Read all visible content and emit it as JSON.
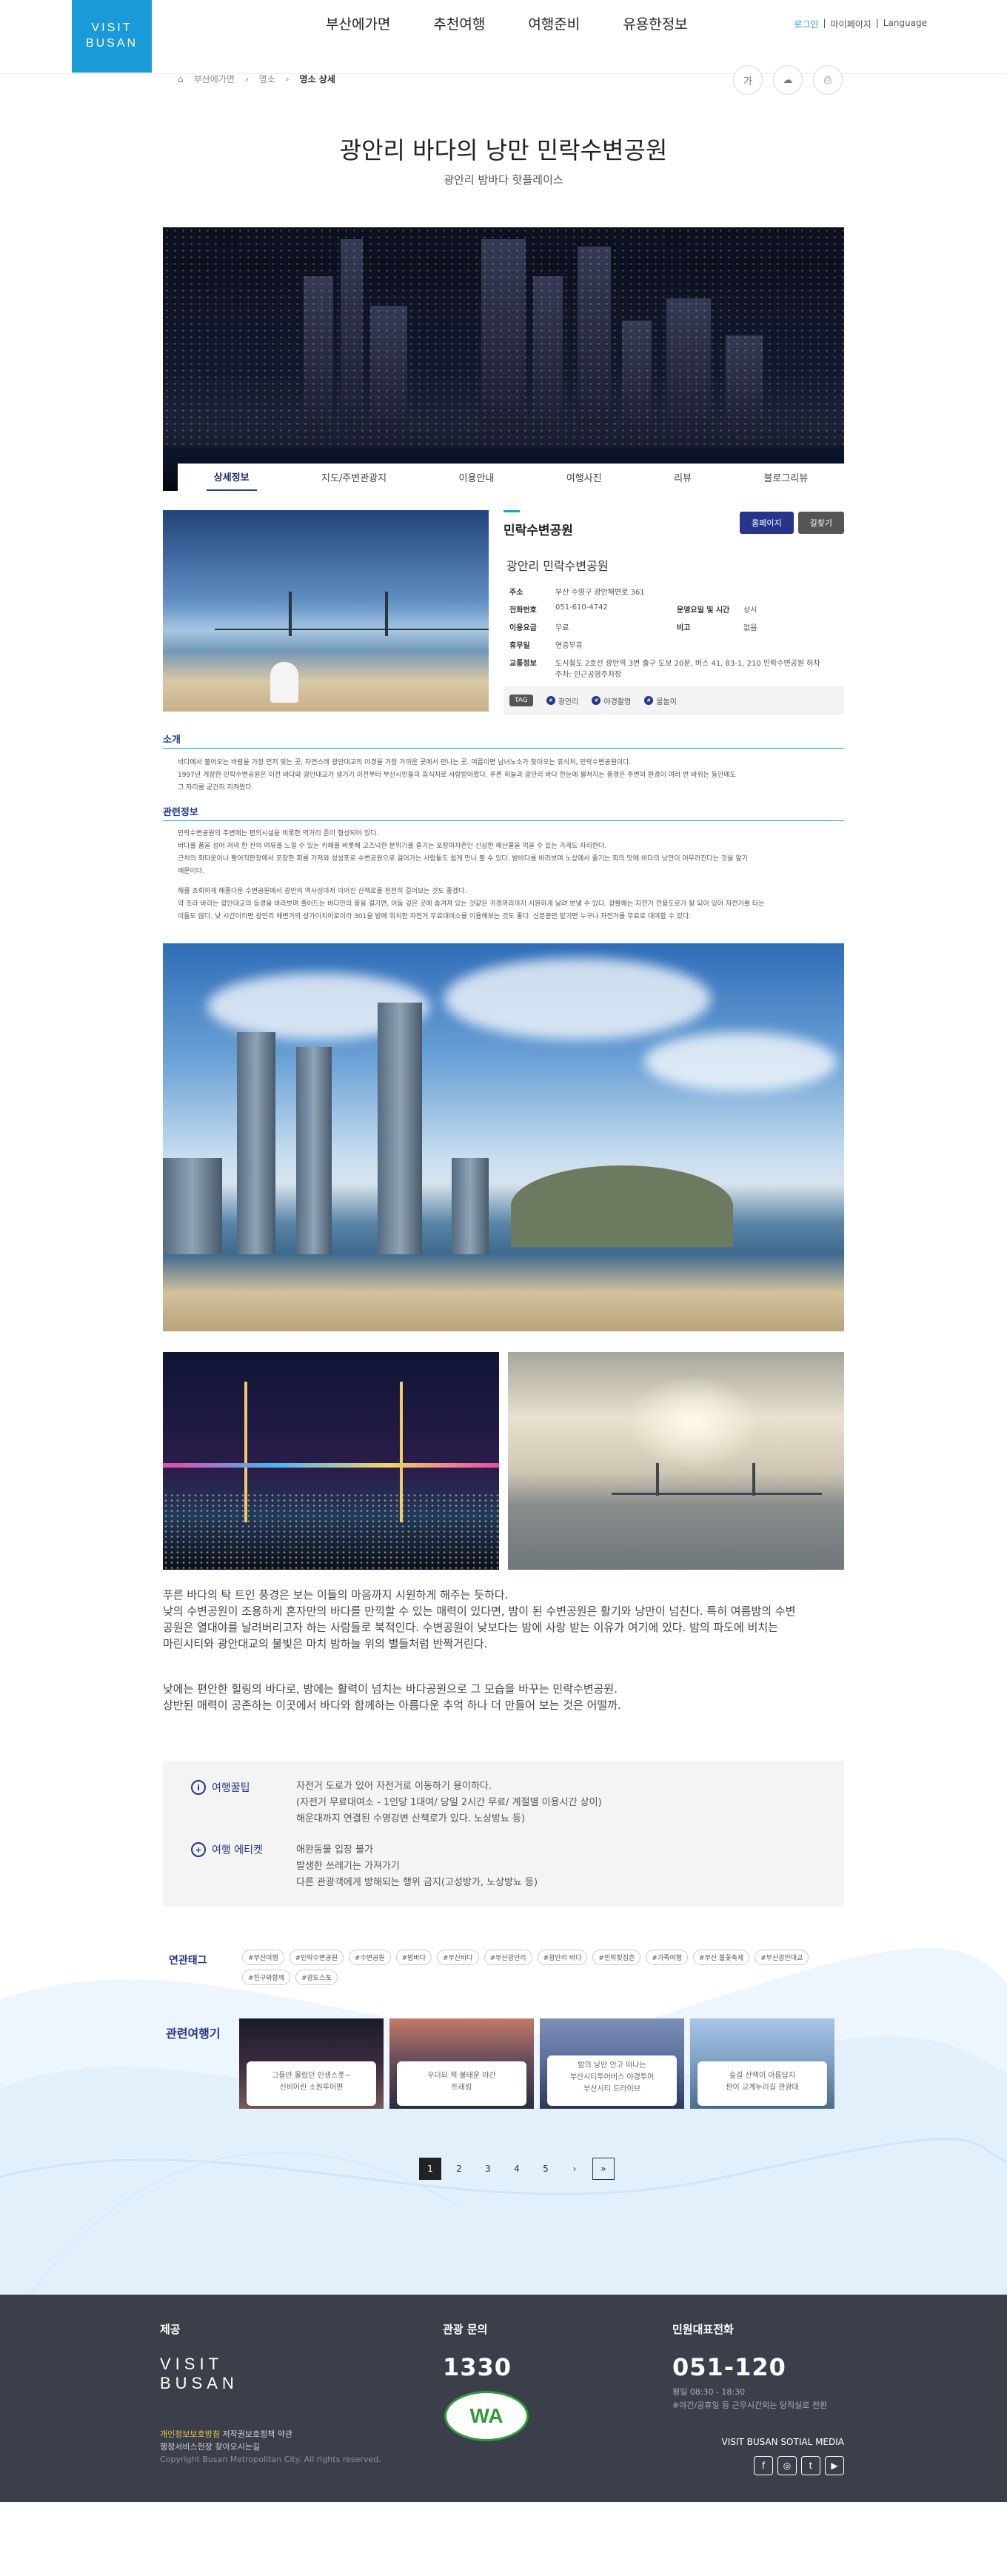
{
  "header": {
    "logo_line1": "VISIT",
    "logo_line2": "BUSAN",
    "nav": [
      "부산에가면",
      "추천여행",
      "여행준비",
      "유용한정보"
    ],
    "login": "로그인",
    "mypage": "마이페이지",
    "language": "Language"
  },
  "breadcrumb": [
    "부산에가면",
    "명소",
    "명소 상세"
  ],
  "tools": [
    "가",
    "",
    ""
  ],
  "title": "광안리 바다의 낭만 민락수변공원",
  "subtitle": "광안리 밤바다 핫플레이스",
  "tabs": [
    "상세정보",
    "지도/주변관광지",
    "이용안내",
    "여행사진",
    "리뷰",
    "블로그리뷰"
  ],
  "info": {
    "section_name": "민락수변공원",
    "home_btn": "홈페이지",
    "way_btn": "길찾기",
    "place_title": "광안리 민락수변공원",
    "addr_k": "주소",
    "addr_v": "부산 수영구 광안해변로 361",
    "tel_k": "전화번호",
    "tel_v": "051-610-4742",
    "hours_k": "운영요일 및 시간",
    "hours_v": "상시",
    "fee_k": "이용요금",
    "fee_v": "무료",
    "note_k": "비고",
    "note_v": "없음",
    "holiday_k": "휴무일",
    "holiday_v": "연중무휴",
    "traffic_k": "교통정보",
    "traffic_v": "도시철도 2호선 광안역 3번 출구 도보 20분, 버스 41, 83-1, 210 민락수변공원 하차",
    "traffic_v2": "주차: 인근공영주차장",
    "tag_label": "TAG",
    "tags": [
      "광안리",
      "야경촬영",
      "물놀이"
    ]
  },
  "sections": {
    "intro_h": "소개",
    "intro": "바다에서 불어오는 바람을 가장 먼저 맞는 곳, 자연스레 광안대교의 야경을 가장 가까운 곳에서 만나는 곳. 여름이면 남녀노소가 찾아오는 휴식처, 민락수변공원이다.",
    "intro2": "1997년 개장한 민락수변공원은 이전 바다와 광안대교가 생기기 이전부터 부산시민들의 휴식처로 사랑받아왔다. 푸른 하늘과 광안리 바다 한눈에 펼쳐지는 풍경은 주변의 환경이 여러 번 바뀌는 동안에도",
    "intro3": "그 자리를 굳건히 지켜왔다.",
    "detail_h": "관련정보",
    "d1": "민락수변공원의 주변에는 편의시설을 비롯한 먹거리 존이 형성되어 있다.",
    "d2": "바다를 품을 성어 저녁 한 잔의 여유를 느낄 수 있는 카페를 비롯해 고즈넉한 분위기를 즐기는 포장마차촌인 신상한 해산물을 먹을 수 있는 가게도 자리한다.",
    "d3": "근처의 회타운이나 활어직판장에서 포장한 회를 가져와 성성포로 수변공원으로 걸어가는 사람들도 쉽게 만나 볼 수 있다. 밤바다를 바라보며 노상에서 즐기는 회의 맛에 바다의 낭만이 어우러진다는 것을 알기",
    "d4": "때문이다.",
    "d5": "해를 조회하게 해풍다운 수변공원에서 광안의 역사성마저 이어진 산책로를 천천히 걸어보는 것도 좋겠다.",
    "d6": "약 조라 바라는 광안대교의 등경을 바라보며 줄어드는 바다만의 풍을 걸기면, 어둠 깊은 곳에 숨겨져 있는 것같은 귀경꺼리까지 시원하게 날려 보낼 수 있다. 광활해는 자전거 전용도로가 잘 되어 있어 자전거를 타는",
    "d7": "이들도 많다. 낮 시간이라면 광안리 해변가의 상가이치이로이라 301을 방에 위치한 자전거 무료대여소를 이용해보는 것도 좋다. 신분증만 맡기면 누구나 자전거를 무료로 대여할 수 있다."
  },
  "story": {
    "p1": "푸른 바다의 탁 트인 풍경은 보는 이들의 마음까지 시원하게 해주는 듯하다.",
    "p2": "낮의 수변공원이 조용하게 혼자만의 바다를 만끽할 수 있는 매력이 있다면, 밤이 된 수변공원은 활기와 낭만이 넘친다. 특히 여름밤의 수변",
    "p3": "공원은 열대야를 날려버리고자 하는 사람들로 북적인다. 수변공원이 낮보다는 밤에 사랑 받는 이유가 여기에 있다. 밤의 파도에 비치는",
    "p4": "마린시티와 광안대교의 불빛은 마치 밤하늘 위의 별들처럼 반짝거린다.",
    "p5": "낮에는 편안한 힐링의 바다로, 밤에는 활력이 넘치는 바다공원으로 그 모습을 바꾸는 민락수변공원.",
    "p6": "상반된 매력이 공존하는 이곳에서 바다와 함께하는 아름다운 추억 하나 더 만들어 보는 것은 어떨까."
  },
  "tips": {
    "tip_h": "여행꿀팁",
    "tip1": "자전거 도로가 있어 자전거로 이동하기 용이하다.",
    "tip2": "(자전거 무료대여소 - 1인당 1대여/ 당일 2시간 무료/ 계절별 이용시간 상이)",
    "tip3": "해운대까지 연결된 수영강변 산책로가 있다. 노상방뇨 등)",
    "et_h": "여행 에티켓",
    "et1": "애완동물 입장 불가",
    "et2": "발생한 쓰레기는 가져가기",
    "et3": "다른 관광객에게 방해되는 행위 금지(고성방가, 노상방뇨 등)"
  },
  "related_tags": {
    "label": "연관태그",
    "tags": [
      "#부산여행",
      "#민락수변공원",
      "#수변공원",
      "#밤바다",
      "#부산바다",
      "#부산광안리",
      "#광안리 바다",
      "#민락횟집촌",
      "#가족여행",
      "#부산 불꽃축제",
      "#부산광안대교",
      "#친구와함께",
      "#광도스포"
    ]
  },
  "related_trips": {
    "label": "관련여행기",
    "cards": [
      [
        "그들만 몰랐던 인생스폿~",
        "신비어린 소원투어편"
      ],
      [
        "우더되 책 불태운 야간",
        "트래킹"
      ],
      [
        "밤의 낭만 안고 떠나는",
        "부산시티투어버스 야경투어",
        "부산시티 드라이브"
      ],
      [
        "숲길 산책이 아름답지",
        "판이 교계누리길 관광대"
      ]
    ]
  },
  "pager": [
    "1",
    "2",
    "3",
    "4",
    "5",
    "›",
    "»"
  ],
  "footer": {
    "col1_h": "제공",
    "logo1": "VISIT",
    "logo2": "BUSAN",
    "link1": "개인정보보호방침",
    "link1b": " 저작권보호정책 약관",
    "link2": "행정서비스헌장 찾아오시는길",
    "copy": "Copyright Busan Metropolitan City. All rights reserved.",
    "col2_h": "관광 문의",
    "col2_num": "1330",
    "wa": "WA",
    "col3_h": "민원대표전화",
    "col3_num": "051-120",
    "col3_s1": "평일 08:30 - 18:30",
    "col3_s2": "※야간/공휴일 등 근무시간외는 당직실로 전환",
    "sns_label": "VISIT BUSAN SOTIAL MEDIA",
    "sns": [
      "f",
      "◎",
      "t",
      "▶"
    ]
  }
}
